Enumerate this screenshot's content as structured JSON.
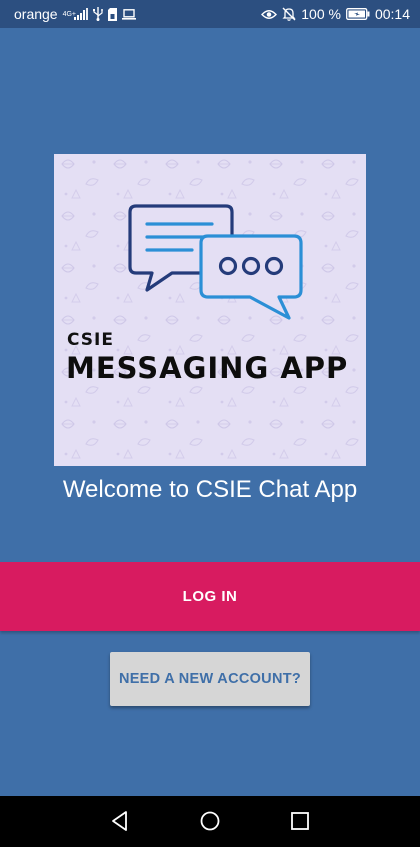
{
  "status_bar": {
    "carrier": "orange",
    "network_type": "4G+",
    "battery_percent": "100 %",
    "time": "00:14",
    "icons": [
      "signal-icon",
      "usb-icon",
      "sim-icon",
      "laptop-icon",
      "eye-icon",
      "bell-off-icon",
      "battery-icon"
    ]
  },
  "logo": {
    "small_text": "CSIE",
    "title": "MESSAGING APP",
    "icon": "chat-bubbles-icon",
    "colors": {
      "background": "#e4dff4",
      "dark_bubble": "#243b7a",
      "light_bubble": "#2b8fd6"
    }
  },
  "welcome_text": "Welcome to CSIE Chat App",
  "buttons": {
    "login": "LOG IN",
    "new_account": "NEED A NEW ACCOUNT?"
  },
  "nav_bar": {
    "icons": [
      "back-icon",
      "home-icon",
      "recents-icon"
    ]
  },
  "colors": {
    "background": "#3f6fa8",
    "status_bar": "#2c4f80",
    "login_button": "#d81b60",
    "secondary_button": "#d6d6d6"
  }
}
